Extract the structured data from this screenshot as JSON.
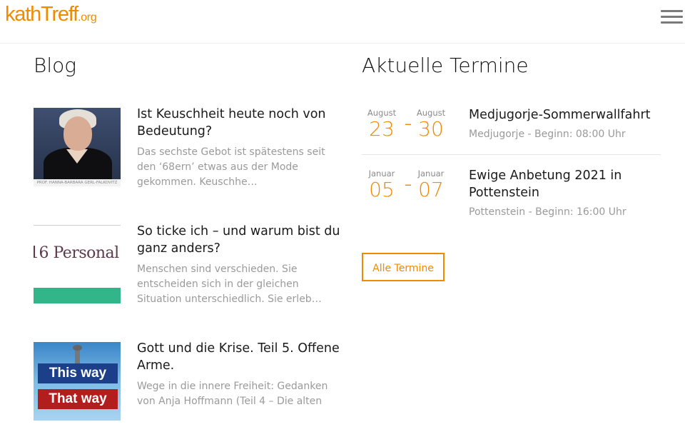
{
  "header": {
    "logo_main": "kathTreff",
    "logo_tld": ".org",
    "menu_icon": "hamburger-menu-icon"
  },
  "blog": {
    "title": "Blog",
    "posts": [
      {
        "title": "Ist Keuschheit heute noch von Bedeutung?",
        "excerpt": "Das sechste Gebot ist spätestens seit den ‘68ern’ etwas aus der Mode gekommen. Keuschhe…",
        "image_caption": "PROF. HANNA-BARBARA GERL-FALKOVITZ"
      },
      {
        "title": "So ticke ich – und warum bist du ganz anders?",
        "excerpt": "Menschen sind verschieden. Sie entscheiden sich in der gleichen Situation unterschiedlich. Sie erleb…",
        "image_text": "16 Personal"
      },
      {
        "title": "Gott und die Krise. Teil 5. Offene Arme.",
        "excerpt": "Wege in die innere Freiheit: Gedanken von Anja Hoffmann (Teil 4 – Die alten",
        "image_sign_1": "This way",
        "image_sign_2": "That way"
      }
    ]
  },
  "termine": {
    "title": "Aktuelle Termine",
    "events": [
      {
        "start_month": "August",
        "start_day": "23",
        "end_month": "August",
        "end_day": "30",
        "dash": "–",
        "title": "Medjugorje-Sommerwallfahrt",
        "meta": "Medjugorje - Beginn: 08:00 Uhr"
      },
      {
        "start_month": "Januar",
        "start_day": "05",
        "end_month": "Januar",
        "end_day": "07",
        "dash": "–",
        "title": "Ewige Anbetung 2021 in Pottenstein",
        "meta": "Pottenstein - Beginn: 16:00 Uhr"
      }
    ],
    "all_button": "Alle Termine"
  },
  "colors": {
    "accent": "#f08a00",
    "muted_text": "#9a9a9a",
    "divider": "#e6e6e6"
  }
}
